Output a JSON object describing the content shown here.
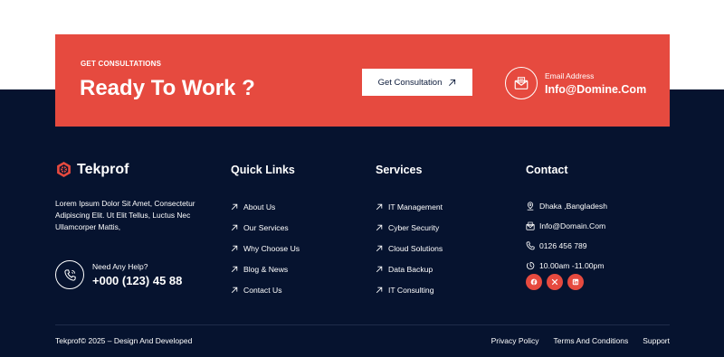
{
  "cta": {
    "kicker": "GET CONSULTATIONS",
    "title": "Ready To Work ?",
    "button_label": "Get Consultation",
    "email_label": "Email Address",
    "email_value": "Info@Domine.Com"
  },
  "brand": {
    "name": "Tekprof",
    "about": "Lorem Ipsum Dolor Sit Amet, Consectetur Adipiscing Elit. Ut Elit Tellus, Luctus Nec Ullamcorper Mattis,",
    "help_label": "Need Any Help?",
    "help_phone": "+000 (123) 45 88"
  },
  "quick_links": {
    "heading": "Quick Links",
    "items": [
      "About Us",
      "Our Services",
      "Why Choose Us",
      "Blog & News",
      "Contact Us"
    ]
  },
  "services": {
    "heading": "Services",
    "items": [
      "IT Management",
      "Cyber Security",
      "Cloud Solutions",
      "Data Backup",
      "IT Consulting"
    ]
  },
  "contact": {
    "heading": "Contact",
    "address": "Dhaka ,Bangladesh",
    "email": "Info@Domain.Com",
    "phone": "0126 456 789",
    "hours": "10.00am -11.00pm",
    "socials": [
      "facebook-icon",
      "x-icon",
      "linkedin-icon"
    ]
  },
  "bottom": {
    "copyright": "Tekprof© 2025 – Design And Developed",
    "links": [
      "Privacy Policy",
      "Terms And Conditions",
      "Support"
    ]
  },
  "colors": {
    "accent": "#e64a3f",
    "footer_bg": "#06132f"
  }
}
